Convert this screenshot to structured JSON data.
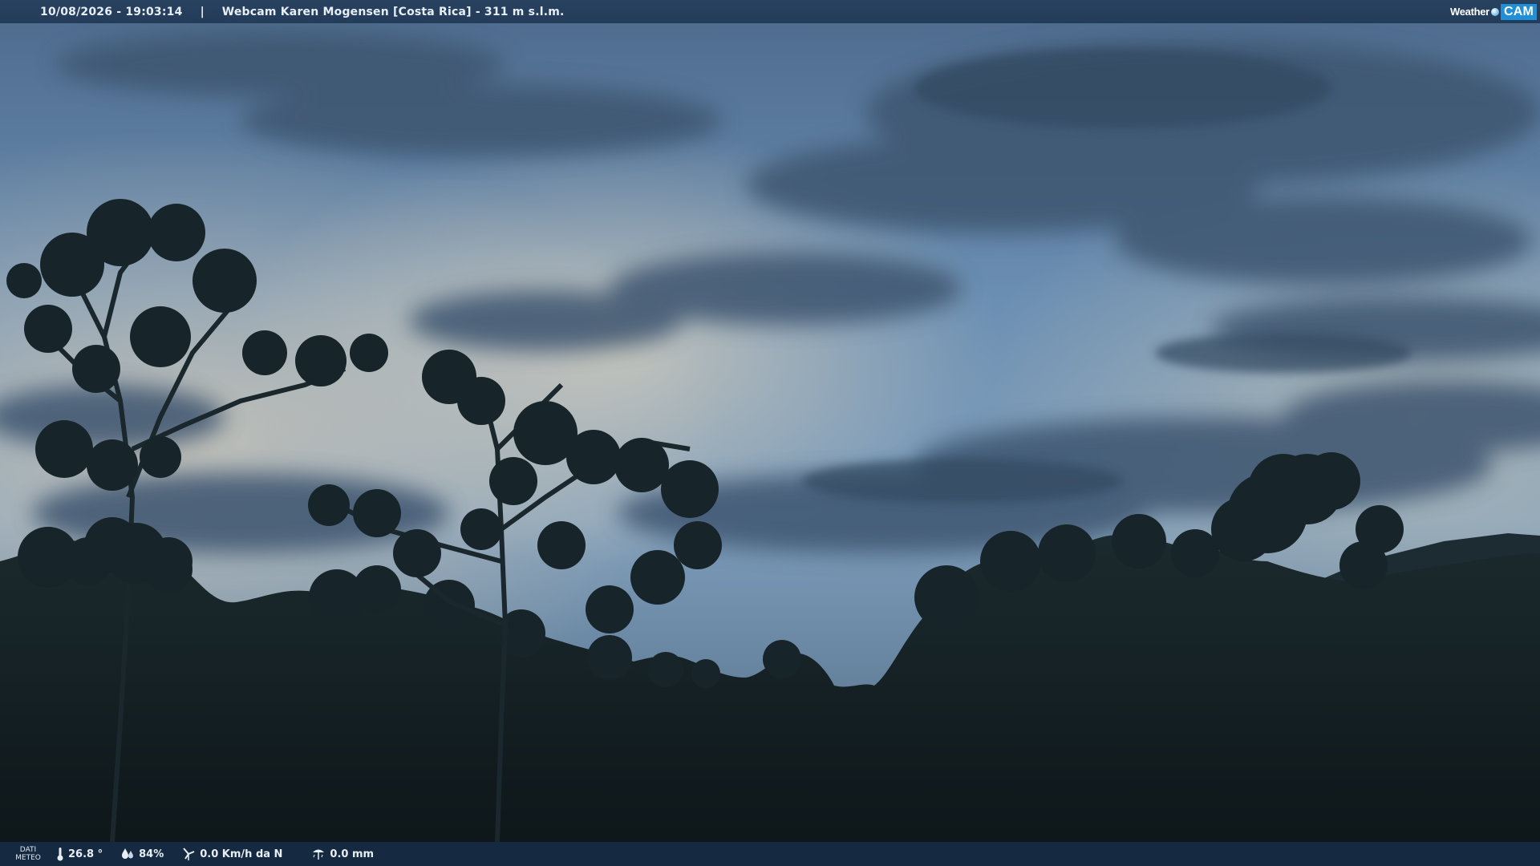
{
  "header": {
    "datetime": "10/08/2026 - 19:03:14",
    "separator": "|",
    "title": "Webcam Karen Mogensen [Costa Rica]  - 311 m s.l.m."
  },
  "brand": {
    "weather": "Weather",
    "cam": "CAM",
    "accent_color": "#1f8fd8"
  },
  "footer": {
    "label_line1": "DATI",
    "label_line2": "METEO",
    "temperature": "26.8 °",
    "humidity": "84%",
    "wind": "0.0 Km/h da N",
    "rain": "0.0 mm",
    "icons": [
      "thermometer-icon",
      "humidity-icon",
      "wind-icon",
      "rain-gauge-icon"
    ]
  }
}
